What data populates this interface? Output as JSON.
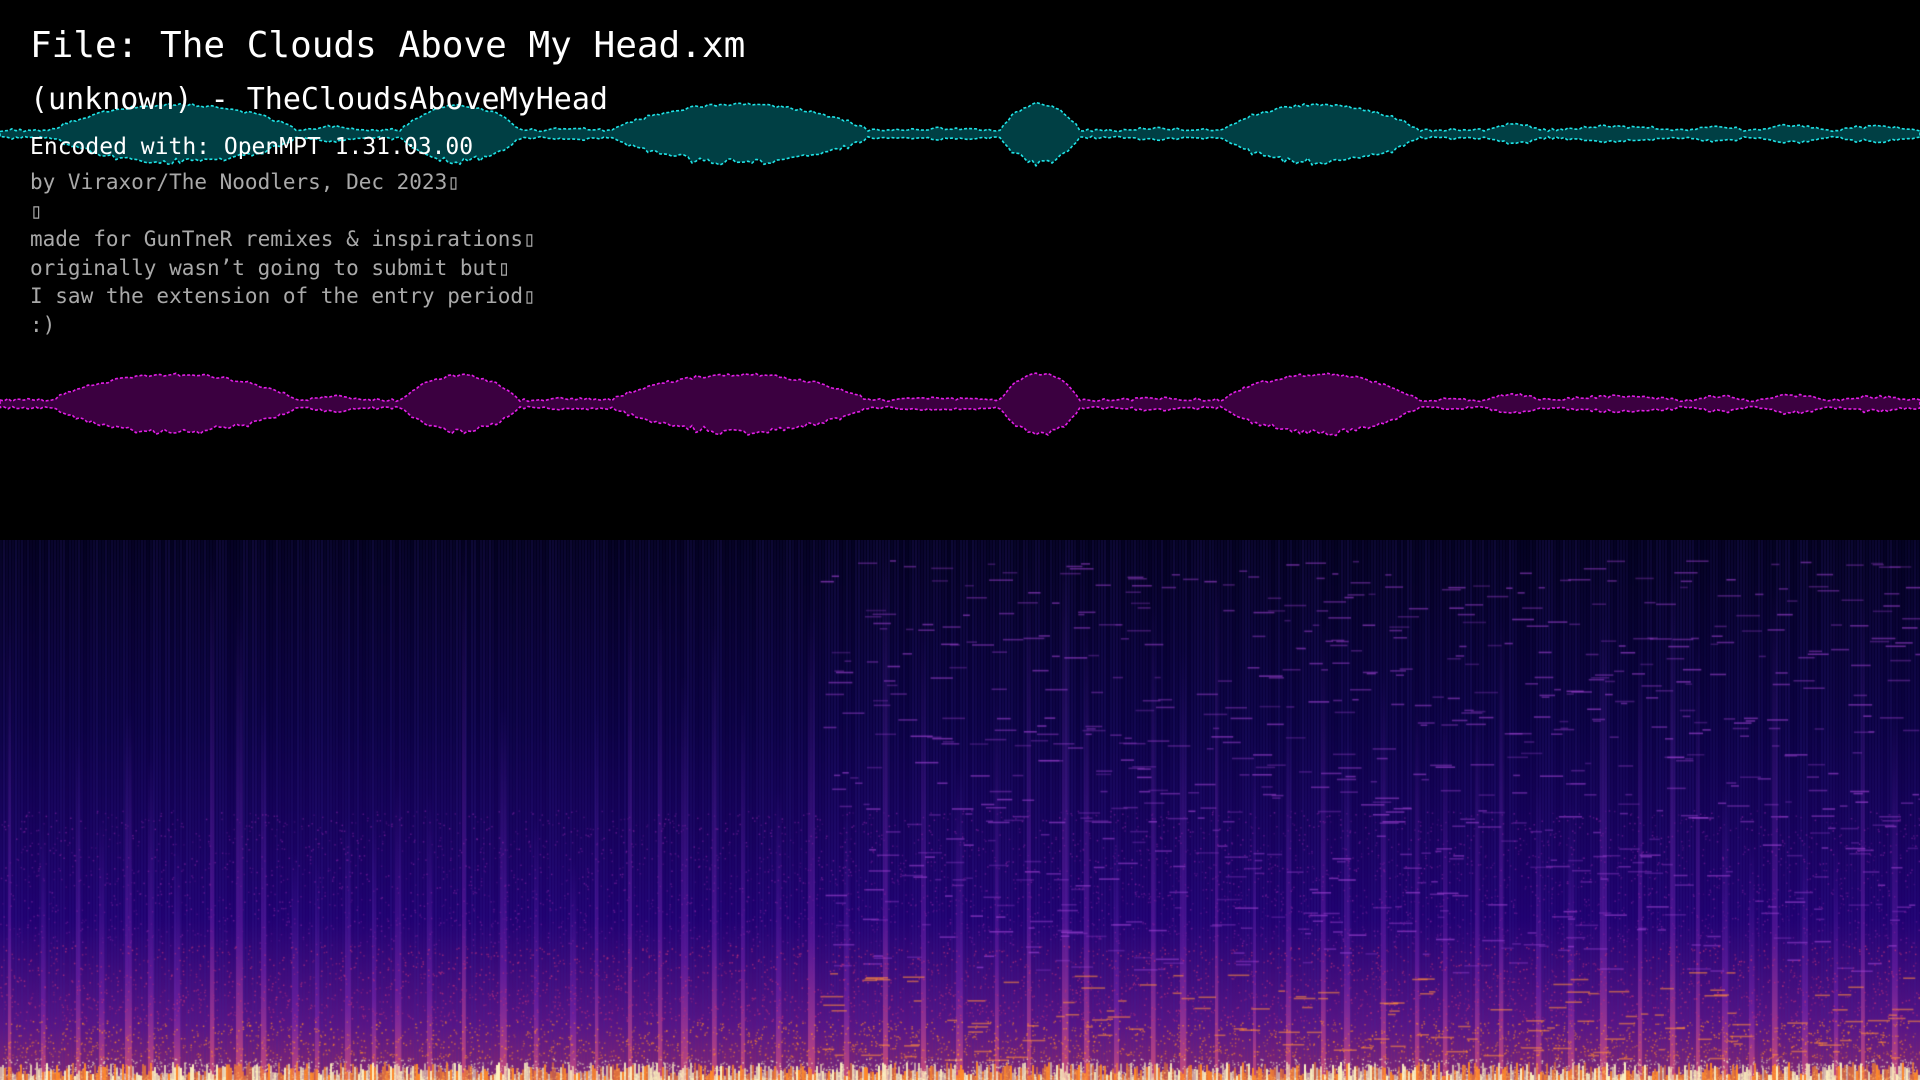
{
  "file_title": "File: The Clouds Above My Head.xm",
  "track_title": "(unknown) - TheCloudsAboveMyHead",
  "encoder": "Encoded with: OpenMPT 1.31.03.00",
  "comment_lines": [
    "by Viraxor/The Noodlers, Dec 2023▯",
    "▯",
    "made for GunTneR remixes & inspirations▯",
    "originally wasn’t going to submit but▯",
    "I saw the extension of the entry period▯",
    ":)"
  ],
  "colors": {
    "background": "#000000",
    "left_channel_fill": "#003f44",
    "left_channel_edge": "#1fe3e6",
    "right_channel_fill": "#3b0040",
    "right_channel_edge": "#e21fe6",
    "spectrogram_low": "#0a0030",
    "spectrogram_mid": "#7a1f9c",
    "spectrogram_high": "#ff8a2a",
    "spectrogram_peak": "#fff4c0"
  }
}
